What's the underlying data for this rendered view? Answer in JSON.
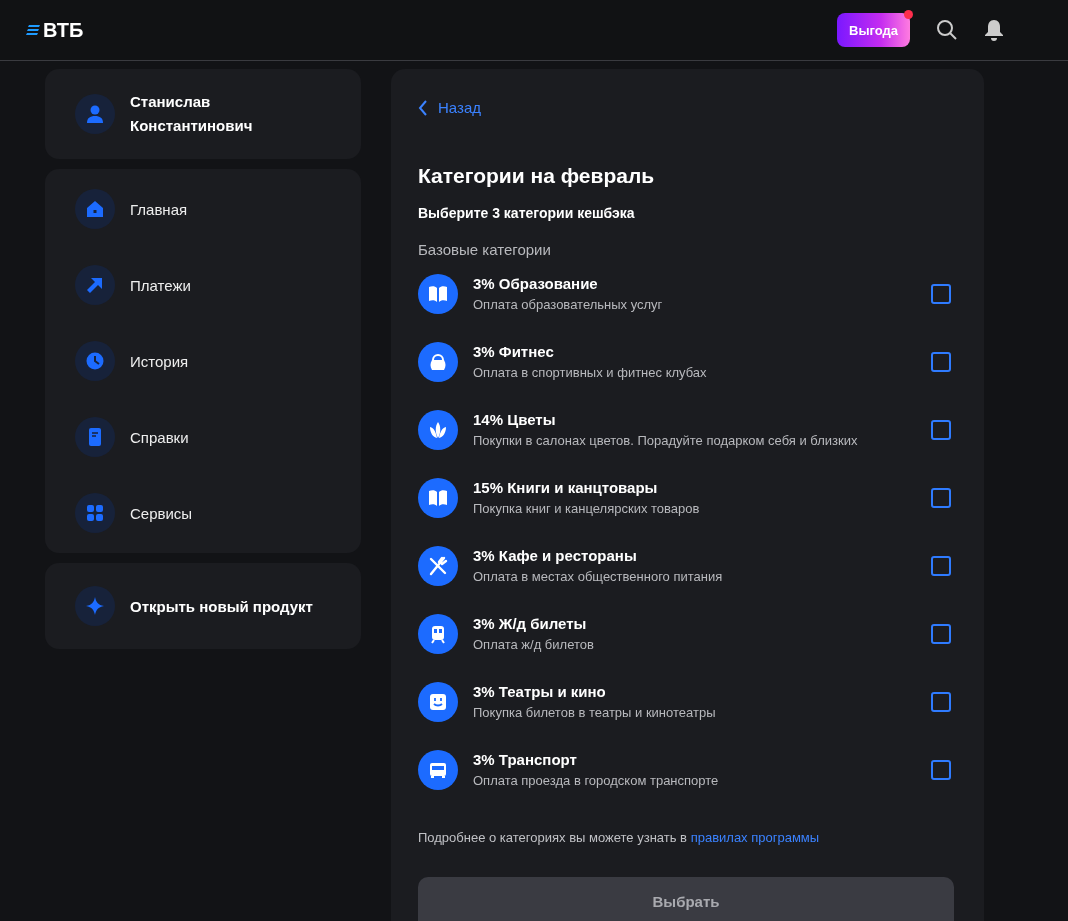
{
  "header": {
    "logo": "ВТБ",
    "promo_button": {
      "label": "Выгода",
      "has_notification": true
    }
  },
  "profile": {
    "name": "Станислав Константинович"
  },
  "sidebar": {
    "items": [
      {
        "label": "Главная",
        "kind": "home"
      },
      {
        "label": "Платежи",
        "kind": "payments"
      },
      {
        "label": "История",
        "kind": "history"
      },
      {
        "label": "Справки",
        "kind": "document"
      },
      {
        "label": "Сервисы",
        "kind": "services"
      }
    ]
  },
  "new_product": {
    "label": "Открыть новый продукт"
  },
  "main": {
    "back_link": "Назад",
    "title": "Категории на февраль",
    "subtitle": "Выберите 3 категории кешбэка",
    "section_title": "Базовые категории",
    "categories": [
      {
        "title": "3% Образование",
        "description": "Оплата образовательных услуг",
        "kind": "book",
        "checked": false
      },
      {
        "title": "3% Фитнес",
        "description": "Оплата в спортивных и фитнес клубах",
        "kind": "kettlebell",
        "checked": false
      },
      {
        "title": "14% Цветы",
        "description": "Покупки в салонах цветов. Порадуйте подарком себя и близких",
        "kind": "flower",
        "checked": false
      },
      {
        "title": "15% Книги и канцтовары",
        "description": "Покупка книг и канцелярских товаров",
        "kind": "book",
        "checked": false
      },
      {
        "title": "3% Кафе и рестораны",
        "description": "Оплата в местах общественного питания",
        "kind": "cutlery",
        "checked": false
      },
      {
        "title": "3% Ж/д билеты",
        "description": "Оплата ж/д билетов",
        "kind": "train",
        "checked": false
      },
      {
        "title": "3% Театры и кино",
        "description": "Покупка билетов в театры и кинотеатры",
        "kind": "smile",
        "checked": false
      },
      {
        "title": "3% Транспорт",
        "description": "Оплата проезда в городском транспорте",
        "kind": "bus",
        "checked": false
      }
    ],
    "footnote": "Подробнее о категориях вы можете узнать в",
    "footnote_link": "правилах программы",
    "submit_button": {
      "label": "Выбрать",
      "disabled": true
    }
  }
}
